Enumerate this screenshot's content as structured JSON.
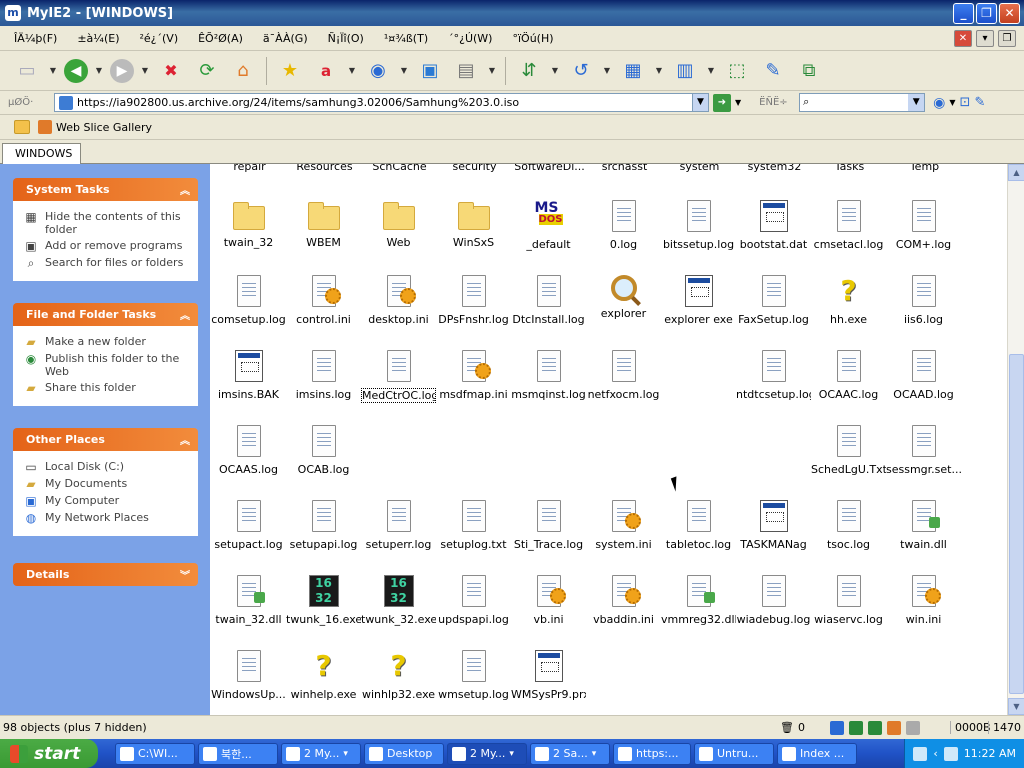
{
  "window": {
    "title": "MyIE2 - [WINDOWS]"
  },
  "menu": [
    "ÎÄ¼þ(F)",
    "±à¼­(E)",
    "²é¿´(V)",
    "ÊÕ²Ø(A)",
    "ä¯ÀÀ(G)",
    "Ñ¡Ïî(O)",
    "¹¤¾ß(T)",
    "´°¿Ú(W)",
    "°ïÖú(H)"
  ],
  "address": {
    "label": "µØÖ·",
    "url": "https://ia902800.us.archive.org/24/items/samhung3.02006/Samhung%203.0.iso",
    "search_label": "ËÑË÷"
  },
  "links": {
    "web_slice": "Web Slice Gallery"
  },
  "tab": {
    "label": "WINDOWS"
  },
  "partial_row": [
    "repair",
    "Resources",
    "SchCache",
    "security",
    "SoftwareDi...",
    "srchasst",
    "system",
    "system32",
    "Tasks",
    "Temp"
  ],
  "panels": {
    "system_tasks": {
      "title": "System Tasks",
      "items": [
        "Hide the contents of this folder",
        "Add or remove programs",
        "Search for files or folders"
      ]
    },
    "file_folder_tasks": {
      "title": "File and Folder Tasks",
      "items": [
        "Make a new folder",
        "Publish this folder to the Web",
        "Share this folder"
      ]
    },
    "other_places": {
      "title": "Other Places",
      "items": [
        "Local Disk (C:)",
        "My Documents",
        "My Computer",
        "My Network Places"
      ]
    },
    "details": {
      "title": "Details"
    }
  },
  "files": [
    {
      "name": "twain_32",
      "type": "folder"
    },
    {
      "name": "WBEM",
      "type": "folder"
    },
    {
      "name": "Web",
      "type": "folder"
    },
    {
      "name": "WinSxS",
      "type": "folder"
    },
    {
      "name": "_default",
      "type": "msdos"
    },
    {
      "name": "0.log",
      "type": "doc"
    },
    {
      "name": "bitssetup.log",
      "type": "doc"
    },
    {
      "name": "bootstat.dat",
      "type": "exe"
    },
    {
      "name": "cmsetacl.log",
      "type": "doc"
    },
    {
      "name": "COM+.log",
      "type": "doc"
    },
    {
      "name": "comsetup.log",
      "type": "doc"
    },
    {
      "name": "control.ini",
      "type": "ini"
    },
    {
      "name": "desktop.ini",
      "type": "ini"
    },
    {
      "name": "DPsFnshr.log",
      "type": "doc"
    },
    {
      "name": "DtcInstall.log",
      "type": "doc"
    },
    {
      "name": "explorer",
      "type": "magnifier"
    },
    {
      "name": "explorer exe",
      "type": "exe"
    },
    {
      "name": "FaxSetup.log",
      "type": "doc"
    },
    {
      "name": "hh.exe",
      "type": "help"
    },
    {
      "name": "iis6.log",
      "type": "doc"
    },
    {
      "name": "imsins.BAK",
      "type": "exe"
    },
    {
      "name": "imsins.log",
      "type": "doc"
    },
    {
      "name": "MedCtrOC.log",
      "type": "doc",
      "selected": true
    },
    {
      "name": "msdfmap.ini",
      "type": "ini"
    },
    {
      "name": "msmqinst.log",
      "type": "doc"
    },
    {
      "name": "netfxocm.log",
      "type": "doc"
    },
    {
      "name": "",
      "type": "empty"
    },
    {
      "name": "ntdtcsetup.log",
      "type": "doc"
    },
    {
      "name": "OCAAC.log",
      "type": "doc"
    },
    {
      "name": "OCAAD.log",
      "type": "doc"
    },
    {
      "name": "OCAAS.log",
      "type": "doc"
    },
    {
      "name": "OCAB.log",
      "type": "doc"
    },
    {
      "name": "",
      "type": "empty"
    },
    {
      "name": "",
      "type": "empty"
    },
    {
      "name": "",
      "type": "empty"
    },
    {
      "name": "",
      "type": "empty"
    },
    {
      "name": "",
      "type": "empty"
    },
    {
      "name": "",
      "type": "empty"
    },
    {
      "name": "SchedLgU.Txt",
      "type": "doc"
    },
    {
      "name": "sessmgr.set...",
      "type": "doc"
    },
    {
      "name": "setupact.log",
      "type": "doc"
    },
    {
      "name": "setupapi.log",
      "type": "doc"
    },
    {
      "name": "setuperr.log",
      "type": "doc"
    },
    {
      "name": "setuplog.txt",
      "type": "doc"
    },
    {
      "name": "Sti_Trace.log",
      "type": "doc"
    },
    {
      "name": "system.ini",
      "type": "ini"
    },
    {
      "name": "tabletoc.log",
      "type": "doc"
    },
    {
      "name": "TASKMANag",
      "type": "exe"
    },
    {
      "name": "tsoc.log",
      "type": "doc"
    },
    {
      "name": "twain.dll",
      "type": "dll"
    },
    {
      "name": "twain_32.dll",
      "type": "dll"
    },
    {
      "name": "twunk_16.exe",
      "type": "dosicon"
    },
    {
      "name": "twunk_32.exe",
      "type": "dosicon"
    },
    {
      "name": "updspapi.log",
      "type": "doc"
    },
    {
      "name": "vb.ini",
      "type": "ini"
    },
    {
      "name": "vbaddin.ini",
      "type": "ini"
    },
    {
      "name": "vmmreg32.dll",
      "type": "dll"
    },
    {
      "name": "wiadebug.log",
      "type": "doc"
    },
    {
      "name": "wiaservc.log",
      "type": "doc"
    },
    {
      "name": "win.ini",
      "type": "ini"
    },
    {
      "name": "WindowsUp...",
      "type": "doc"
    },
    {
      "name": "winhelp.exe",
      "type": "help"
    },
    {
      "name": "winhlp32.exe",
      "type": "help"
    },
    {
      "name": "wmsetup.log",
      "type": "doc"
    },
    {
      "name": "WMSysPr9.prx",
      "type": "exe"
    }
  ],
  "status": {
    "objects": "98 objects (plus 7 hidden)",
    "count": "0",
    "size": "0000B",
    "extra": "1470"
  },
  "taskbar": {
    "start": "start",
    "tasks": [
      {
        "label": "C:\\WI...",
        "w": 80
      },
      {
        "label": "북한...",
        "w": 80
      },
      {
        "label": "2 My...",
        "w": 80,
        "cnt": "▾"
      },
      {
        "label": "Desktop",
        "w": 80
      },
      {
        "label": "2 My...",
        "w": 80,
        "cnt": "▾",
        "active": true
      },
      {
        "label": "2 Sa...",
        "w": 80,
        "cnt": "▾"
      },
      {
        "label": "https:...",
        "w": 78
      },
      {
        "label": "Untru...",
        "w": 80
      },
      {
        "label": "Index ...",
        "w": 80
      }
    ],
    "clock": "11:22 AM"
  }
}
